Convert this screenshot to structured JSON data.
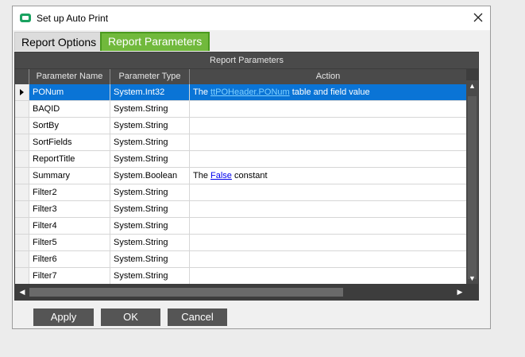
{
  "window": {
    "title": "Set up Auto Print"
  },
  "tabs": [
    {
      "label": "Report Options",
      "active": false
    },
    {
      "label": "Report Parameters",
      "active": true
    }
  ],
  "grid": {
    "caption": "Report Parameters",
    "columns": [
      "Parameter Name",
      "Parameter Type",
      "Action"
    ],
    "rows": [
      {
        "name": "PONum",
        "type": "System.Int32",
        "action_prefix": "The ",
        "action_link": "ttPOHeader.PONum",
        "action_suffix": " table and field value",
        "selected": true
      },
      {
        "name": "BAQID",
        "type": "System.String",
        "action_prefix": "",
        "action_link": "",
        "action_suffix": ""
      },
      {
        "name": "SortBy",
        "type": "System.String",
        "action_prefix": "",
        "action_link": "",
        "action_suffix": ""
      },
      {
        "name": "SortFields",
        "type": "System.String",
        "action_prefix": "",
        "action_link": "",
        "action_suffix": ""
      },
      {
        "name": "ReportTitle",
        "type": "System.String",
        "action_prefix": "",
        "action_link": "",
        "action_suffix": ""
      },
      {
        "name": "Summary",
        "type": "System.Boolean",
        "action_prefix": "The ",
        "action_link": "False",
        "action_suffix": " constant"
      },
      {
        "name": "Filter2",
        "type": "System.String",
        "action_prefix": "",
        "action_link": "",
        "action_suffix": ""
      },
      {
        "name": "Filter3",
        "type": "System.String",
        "action_prefix": "",
        "action_link": "",
        "action_suffix": ""
      },
      {
        "name": "Filter4",
        "type": "System.String",
        "action_prefix": "",
        "action_link": "",
        "action_suffix": ""
      },
      {
        "name": "Filter5",
        "type": "System.String",
        "action_prefix": "",
        "action_link": "",
        "action_suffix": ""
      },
      {
        "name": "Filter6",
        "type": "System.String",
        "action_prefix": "",
        "action_link": "",
        "action_suffix": ""
      },
      {
        "name": "Filter7",
        "type": "System.String",
        "action_prefix": "",
        "action_link": "",
        "action_suffix": ""
      }
    ]
  },
  "buttons": {
    "apply": "Apply",
    "ok": "OK",
    "cancel": "Cancel"
  },
  "colors": {
    "active_tab": "#71b93c",
    "selection": "#0a74d6",
    "button": "#555555"
  }
}
